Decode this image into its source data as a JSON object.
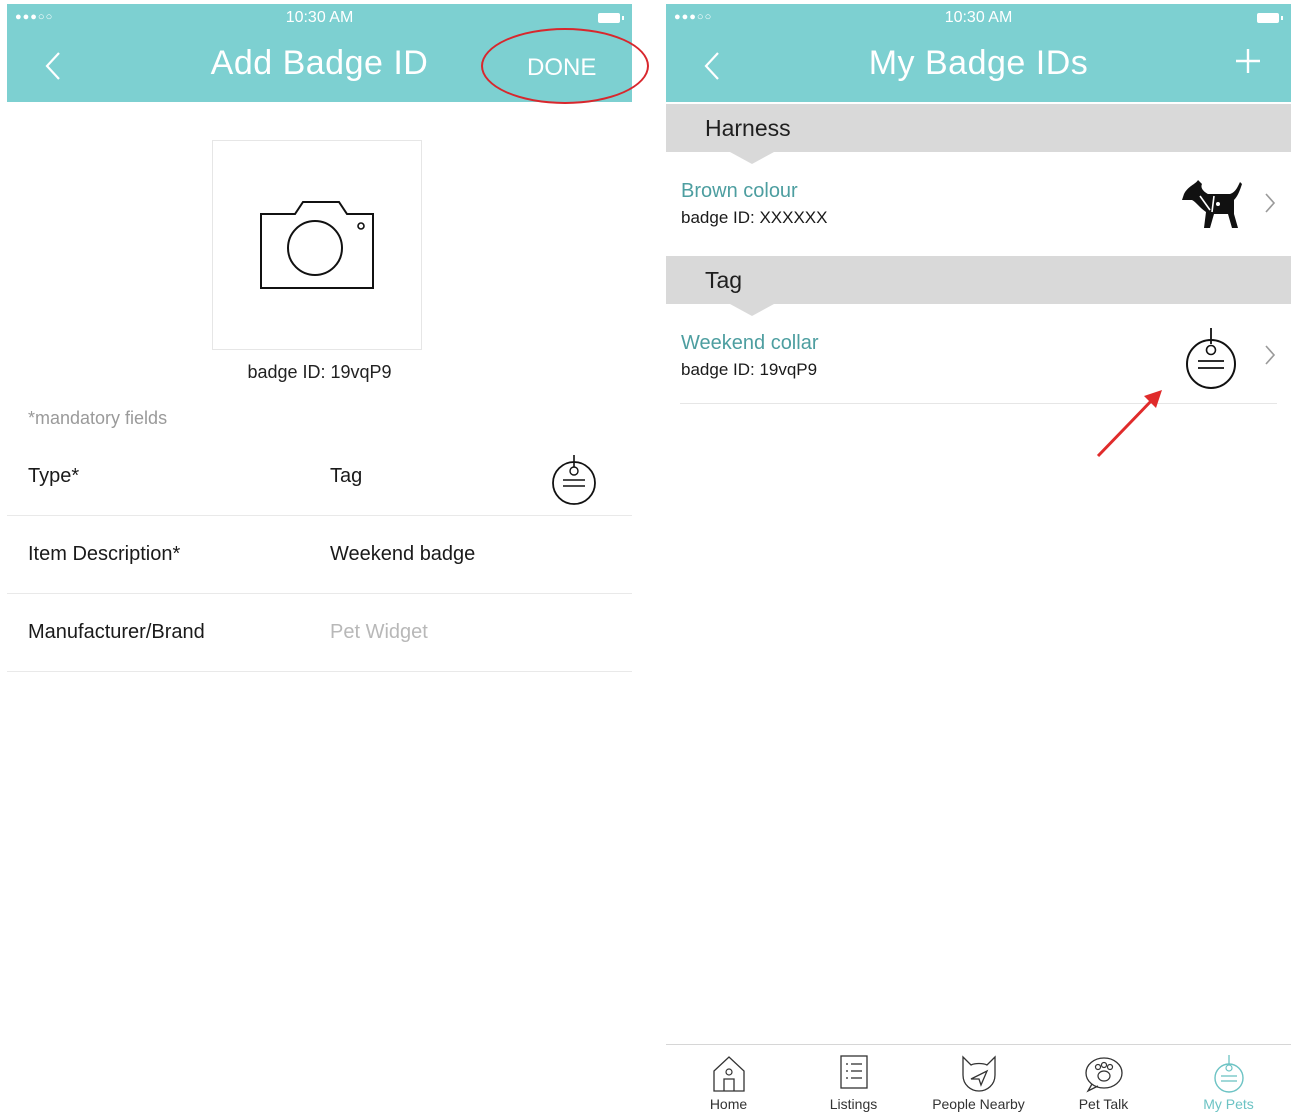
{
  "status_bar": {
    "time": "10:30 AM",
    "signal": "●●●○○"
  },
  "colors": {
    "teal": "#7dd0d1",
    "link_teal": "#4d9ea0",
    "annotation_red": "#d8272d"
  },
  "add_badge": {
    "title": "Add Badge ID",
    "done_label": "DONE",
    "back_icon": "chevron-left-icon",
    "photo_icon": "camera-icon",
    "badge_id_caption": "badge ID: 19vqP9",
    "mandatory_note": "*mandatory fields",
    "fields": [
      {
        "label": "Type*",
        "value": "Tag",
        "icon": "tag-icon"
      },
      {
        "label": "Item Description*",
        "value": "Weekend badge"
      },
      {
        "label": "Manufacturer/Brand",
        "placeholder": "Pet Widget"
      }
    ]
  },
  "my_badges": {
    "title": "My Badge IDs",
    "add_icon": "plus-icon",
    "back_icon": "chevron-left-icon",
    "sections": [
      {
        "header": "Harness",
        "items": [
          {
            "name": "Brown colour",
            "badge_id": "badge ID: XXXXXX",
            "icon": "dog-harness-icon"
          }
        ]
      },
      {
        "header": "Tag",
        "items": [
          {
            "name": "Weekend collar",
            "badge_id": "badge ID: 19vqP9",
            "icon": "tag-icon"
          }
        ]
      }
    ]
  },
  "tabbar": {
    "tabs": [
      {
        "label": "Home",
        "icon": "home-icon",
        "active": false
      },
      {
        "label": "Listings",
        "icon": "listings-icon",
        "active": false
      },
      {
        "label": "People Nearby",
        "icon": "cat-location-icon",
        "active": false
      },
      {
        "label": "Pet Talk",
        "icon": "paw-chat-icon",
        "active": false
      },
      {
        "label": "My Pets",
        "icon": "tag-icon",
        "active": true
      }
    ]
  }
}
